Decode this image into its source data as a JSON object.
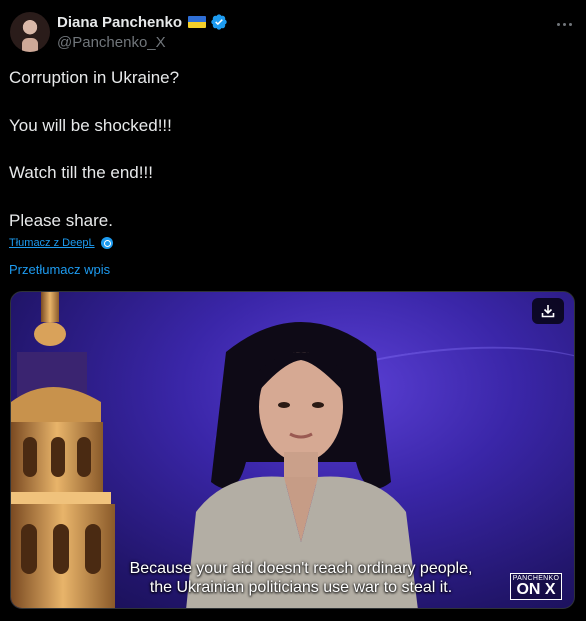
{
  "author": {
    "name": "Diana Panchenko",
    "handle": "@Panchenko_X",
    "flag_colors": [
      "#2f6fd6",
      "#f4cf2a"
    ],
    "verified_color": "#1d9bf0"
  },
  "more_icon": "more-dots-icon",
  "tweet_lines": [
    "Corruption in Ukraine?",
    "You will be shocked!!!",
    "Watch till the end!!!",
    "Please share."
  ],
  "deepl_link": "Tłumacz z DeepL",
  "translate_link": "Przetłumacz wpis",
  "video": {
    "download_icon": "download-icon",
    "subtitle_line1": "Because your aid doesn't reach ordinary people,",
    "subtitle_line2": "the Ukrainian politicians use war to steal it.",
    "brand_top": "PANCHENKO",
    "brand_bottom": "ON X"
  }
}
